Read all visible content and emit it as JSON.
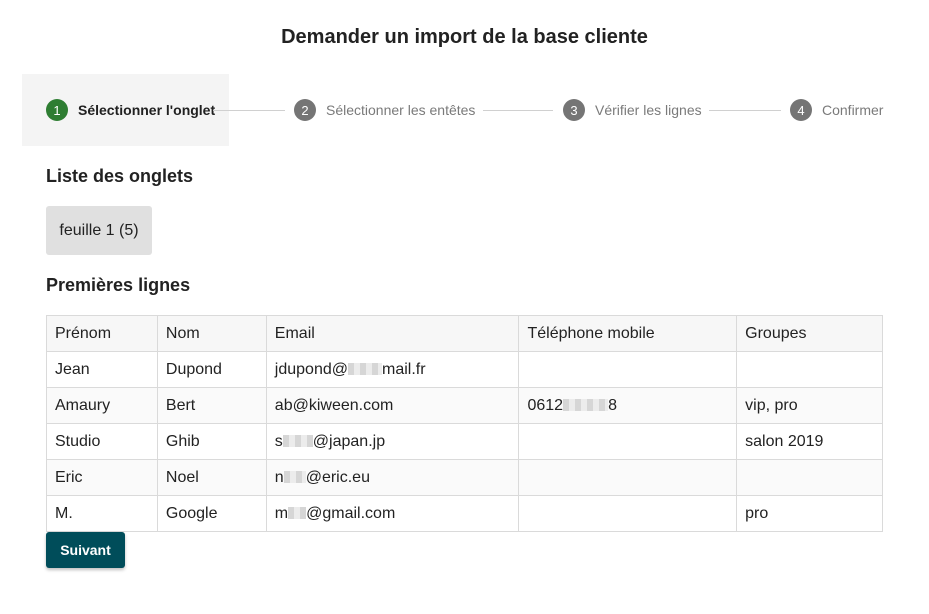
{
  "header": {
    "title": "Demander un import de la base cliente"
  },
  "stepper": {
    "steps": [
      {
        "number": "1",
        "label": "Sélectionner l'onglet",
        "state": "active"
      },
      {
        "number": "2",
        "label": "Sélectionner les entêtes",
        "state": "inactive"
      },
      {
        "number": "3",
        "label": "Vérifier les lignes",
        "state": "inactive"
      },
      {
        "number": "4",
        "label": "Confirmer",
        "state": "inactive"
      }
    ]
  },
  "tabs_section": {
    "title": "Liste des onglets",
    "tabs": [
      {
        "label": "feuille 1 (5)"
      }
    ]
  },
  "preview_section": {
    "title": "Premières lignes",
    "columns": [
      "Prénom",
      "Nom",
      "Email",
      "Téléphone mobile",
      "Groupes"
    ],
    "rows": [
      {
        "prenom": "Jean",
        "nom": "Dupond",
        "email_a": "jdupond@",
        "email_b": "mail.fr",
        "tel_a": "",
        "tel_b": "",
        "groupes": ""
      },
      {
        "prenom": "Amaury",
        "nom": "Bert",
        "email_a": "ab@kiween.com",
        "email_b": "",
        "tel_a": "0612",
        "tel_b": "8",
        "groupes": "vip, pro"
      },
      {
        "prenom": "Studio",
        "nom": "Ghib",
        "email_a": "s",
        "email_b": "@japan.jp",
        "tel_a": "",
        "tel_b": "",
        "groupes": "salon 2019"
      },
      {
        "prenom": "Eric",
        "nom": "Noel",
        "email_a": "n",
        "email_b": "@eric.eu",
        "tel_a": "",
        "tel_b": "",
        "groupes": ""
      },
      {
        "prenom": "M.",
        "nom": "Google",
        "email_a": "m",
        "email_b": "@gmail.com",
        "tel_a": "",
        "tel_b": "",
        "groupes": "pro"
      }
    ]
  },
  "actions": {
    "next_label": "Suivant"
  },
  "colors": {
    "active_step": "#2e7d32",
    "inactive_step": "#757575",
    "primary_button": "#004d5a"
  }
}
